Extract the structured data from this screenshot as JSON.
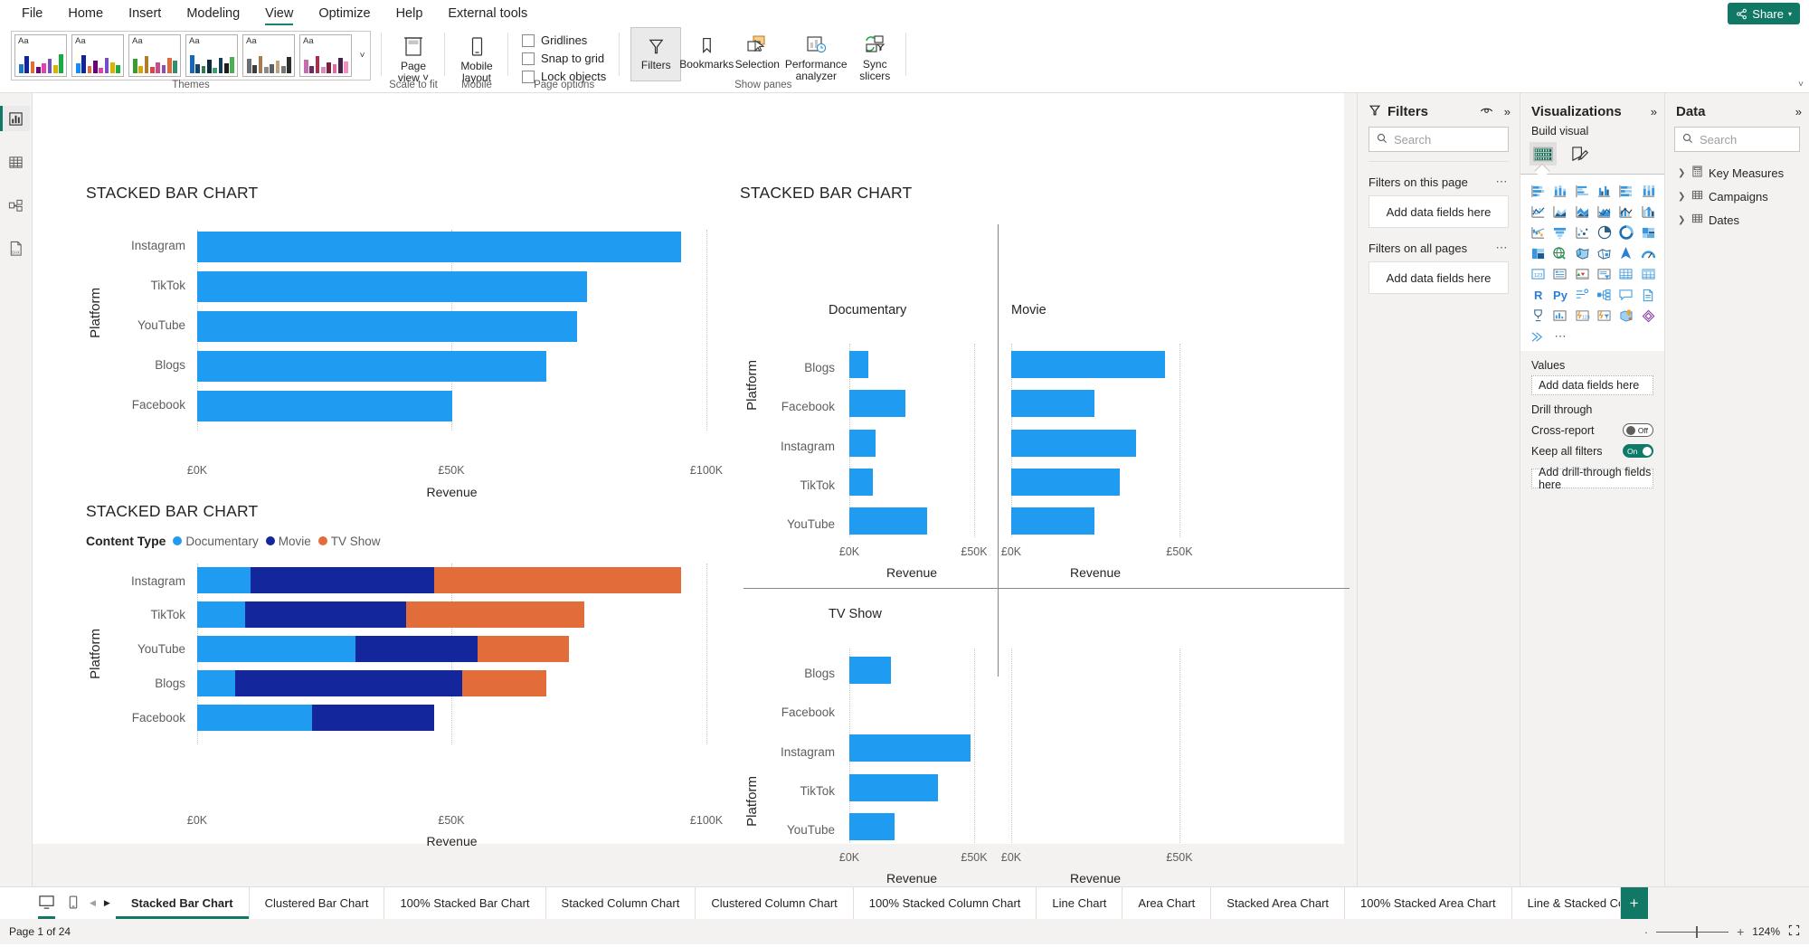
{
  "ribbon": {
    "tabs": [
      "File",
      "Home",
      "Insert",
      "Modeling",
      "View",
      "Optimize",
      "Help",
      "External tools"
    ],
    "active_tab": "View",
    "share_label": "Share",
    "groups": {
      "themes_label": "Themes",
      "scale_label": "Scale to fit",
      "mobile_label": "Mobile",
      "page_options_label": "Page options",
      "show_panes_label": "Show panes"
    },
    "buttons": {
      "page_view": "Page\nview",
      "page_view_l1": "Page",
      "page_view_l2": "view",
      "mobile_layout_l1": "Mobile",
      "mobile_layout_l2": "layout",
      "filters": "Filters",
      "bookmarks": "Bookmarks",
      "selection": "Selection",
      "performance_l1": "Performance",
      "performance_l2": "analyzer",
      "sync_l1": "Sync",
      "sync_l2": "slicers"
    },
    "checkboxes": [
      {
        "label": "Gridlines",
        "checked": false
      },
      {
        "label": "Snap to grid",
        "checked": false
      },
      {
        "label": "Lock objects",
        "checked": false
      }
    ]
  },
  "left_rail": {
    "items": [
      {
        "name": "report-view",
        "active": true
      },
      {
        "name": "table-view",
        "active": false
      },
      {
        "name": "model-view",
        "active": false
      },
      {
        "name": "dax-query-view",
        "active": false
      }
    ]
  },
  "filters_pane": {
    "title": "Filters",
    "search_placeholder": "Search",
    "sections": [
      {
        "label": "Filters on this page",
        "dropzone": "Add data fields here"
      },
      {
        "label": "Filters on all pages",
        "dropzone": "Add data fields here"
      }
    ]
  },
  "visualizations_pane": {
    "title": "Visualizations",
    "subtitle": "Build visual",
    "tabs": [
      "build-visual-icon",
      "format-visual-icon"
    ],
    "gallery_icons": [
      "stacked-bar-chart",
      "stacked-column-chart",
      "clustered-bar-chart",
      "clustered-column-chart",
      "100-stacked-bar-chart",
      "100-stacked-column-chart",
      "line-chart",
      "area-chart",
      "stacked-area-chart",
      "line-and-stacked-column-chart",
      "line-and-clustered-column-chart",
      "ribbon-chart",
      "waterfall-chart",
      "funnel-chart",
      "scatter-chart",
      "pie-chart",
      "donut-chart",
      "treemap",
      "map",
      "filled-map",
      "shape-map",
      "azure-map",
      "arcgis-map",
      "gauge",
      "card",
      "multi-row-card",
      "kpi",
      "slicer",
      "table",
      "matrix",
      "r-script-visual",
      "python-visual",
      "key-influencers",
      "decomposition-tree",
      "qna-visual",
      "paginated-report",
      "metrics",
      "narrative",
      "power-apps",
      "power-automate",
      "arcgis-maps",
      "azure-ml",
      "more-visuals"
    ],
    "values_label": "Values",
    "values_dropzone": "Add data fields here",
    "drill_label": "Drill through",
    "cross_report": {
      "label": "Cross-report",
      "state": "Off",
      "on": false
    },
    "keep_all_filters": {
      "label": "Keep all filters",
      "state": "On",
      "on": true
    },
    "drill_dropzone": "Add drill-through fields here"
  },
  "data_pane": {
    "title": "Data",
    "search_placeholder": "Search",
    "tables": [
      {
        "label": "Key Measures",
        "icon": "measure-table-icon"
      },
      {
        "label": "Campaigns",
        "icon": "table-icon"
      },
      {
        "label": "Dates",
        "icon": "table-icon"
      }
    ]
  },
  "page_tabs": {
    "items": [
      "Stacked Bar Chart",
      "Clustered Bar Chart",
      "100% Stacked Bar Chart",
      "Stacked Column Chart",
      "Clustered Column Chart",
      "100% Stacked Column Chart",
      "Line Chart",
      "Area Chart",
      "Stacked Area Chart",
      "100% Stacked Area Chart",
      "Line & Stacked Column Chart"
    ],
    "active": "Stacked Bar Chart",
    "add_label": "+"
  },
  "statusbar": {
    "page_text": "Page 1 of 24",
    "zoom_label": "124%"
  },
  "colors": {
    "accent": "#117865",
    "bar_blue": "#1f9bf2",
    "documentary": "#1f9bf2",
    "movie": "#13269c",
    "tvshow": "#e36c3b"
  },
  "chart_data": [
    {
      "id": "visual-1",
      "type": "bar",
      "title": "STACKED BAR CHART",
      "xlabel": "Revenue",
      "ylabel": "Platform",
      "categories": [
        "Instagram",
        "TikTok",
        "YouTube",
        "Blogs",
        "Facebook"
      ],
      "values": [
        95000,
        76500,
        74500,
        68500,
        50000
      ],
      "xlim": [
        0,
        100000
      ],
      "xticks": [
        0,
        50000,
        100000
      ],
      "xticklabels": [
        "£0K",
        "£50K",
        "£100K"
      ],
      "grid": true,
      "legend": false
    },
    {
      "id": "visual-2",
      "type": "bar",
      "small_multiples": true,
      "title": "STACKED BAR CHART",
      "xlabel": "Revenue",
      "ylabel": "Platform",
      "categories": [
        "Blogs",
        "Facebook",
        "Instagram",
        "TikTok",
        "YouTube"
      ],
      "xlim": [
        0,
        50000
      ],
      "xticks": [
        0,
        50000
      ],
      "xticklabels": [
        "£0K",
        "£50K"
      ],
      "grid": true,
      "panels": [
        {
          "name": "Documentary",
          "values": [
            7500,
            22500,
            10500,
            9500,
            31000
          ]
        },
        {
          "name": "Movie",
          "values": [
            44500,
            24000,
            36000,
            31500,
            24000
          ]
        },
        {
          "name": "TV Show",
          "values": [
            16500,
            0,
            48000,
            35000,
            18000
          ]
        },
        {
          "name": "",
          "values": []
        }
      ]
    },
    {
      "id": "visual-3",
      "type": "bar",
      "stacked": true,
      "title": "STACKED BAR CHART",
      "xlabel": "Revenue",
      "ylabel": "Platform",
      "legend_title": "Content Type",
      "categories": [
        "Instagram",
        "TikTok",
        "YouTube",
        "Blogs",
        "Facebook"
      ],
      "series": [
        {
          "name": "Documentary",
          "color": "#1f9bf2",
          "values": [
            10500,
            9500,
            31000,
            7500,
            22500
          ]
        },
        {
          "name": "Movie",
          "color": "#13269c",
          "values": [
            36000,
            31500,
            24000,
            44500,
            24000
          ]
        },
        {
          "name": "TV Show",
          "color": "#e36c3b",
          "values": [
            48000,
            35000,
            18000,
            16500,
            0
          ]
        }
      ],
      "xlim": [
        0,
        100000
      ],
      "xticks": [
        0,
        50000,
        100000
      ],
      "xticklabels": [
        "£0K",
        "£50K",
        "£100K"
      ],
      "grid": true,
      "legend": true,
      "legend_position": "top"
    }
  ]
}
